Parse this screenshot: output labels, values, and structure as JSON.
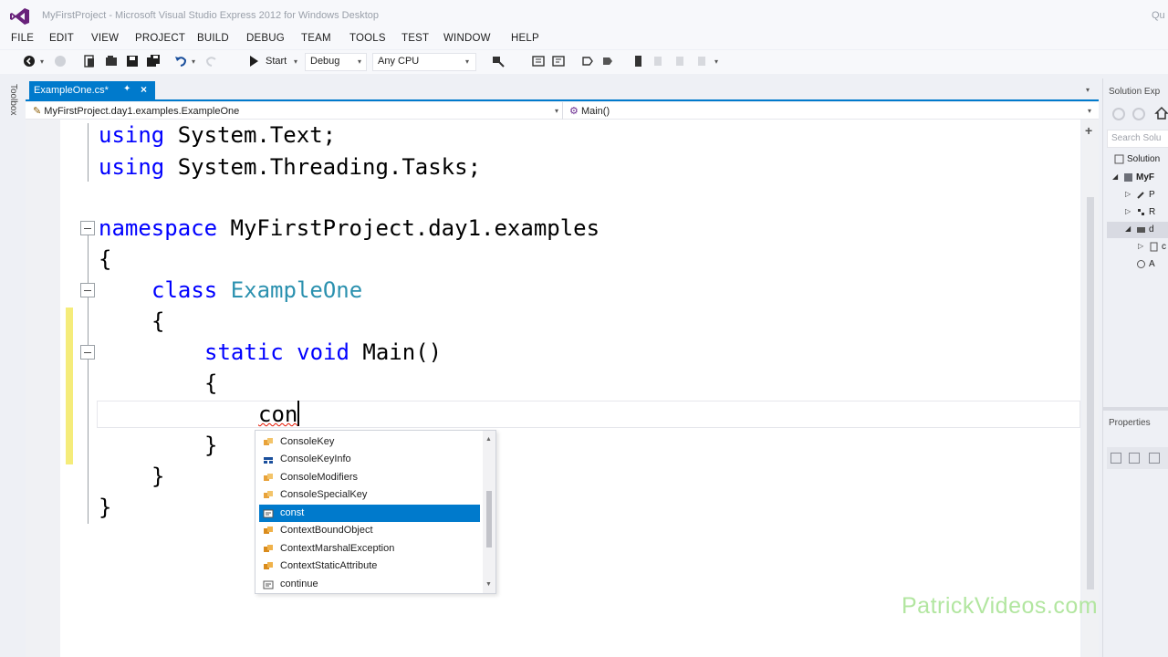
{
  "window": {
    "title": "MyFirstProject - Microsoft Visual Studio Express 2012 for Windows Desktop",
    "title_right": "Qu"
  },
  "menu": [
    "FILE",
    "EDIT",
    "VIEW",
    "PROJECT",
    "BUILD",
    "DEBUG",
    "TEAM",
    "TOOLS",
    "TEST",
    "WINDOW",
    "HELP"
  ],
  "toolbar": {
    "start_label": "Start",
    "configuration": "Debug",
    "platform": "Any CPU"
  },
  "toolbox": {
    "label": "Toolbox"
  },
  "document_tab": {
    "label": "ExampleOne.cs*",
    "pin": "✦",
    "close": "×"
  },
  "navigation": {
    "type_path": "MyFirstProject.day1.examples.ExampleOne",
    "member": "Main()"
  },
  "code": {
    "line1_keyword": "using",
    "line1_rest": " System.Text;",
    "line2_keyword": "using",
    "line2_rest": " System.Threading.Tasks;",
    "line3_keyword": "namespace",
    "line3_rest": " MyFirstProject.day1.examples",
    "line4": "{",
    "line5_keyword": "class",
    "line5_type": "ExampleOne",
    "line6": "{",
    "line7_kw1": "static",
    "line7_kw2": "void",
    "line7_rest": " Main()",
    "line8": "{",
    "line9_typed": "con",
    "line10": "}",
    "line11": "}",
    "line12": "}"
  },
  "intellisense": {
    "items": [
      {
        "label": "ConsoleKey",
        "icon": "enum-icon"
      },
      {
        "label": "ConsoleKeyInfo",
        "icon": "struct-icon"
      },
      {
        "label": "ConsoleModifiers",
        "icon": "enum-icon"
      },
      {
        "label": "ConsoleSpecialKey",
        "icon": "enum-icon"
      },
      {
        "label": "const",
        "icon": "keyword-icon",
        "selected": true
      },
      {
        "label": "ContextBoundObject",
        "icon": "class-icon"
      },
      {
        "label": "ContextMarshalException",
        "icon": "class-icon"
      },
      {
        "label": "ContextStaticAttribute",
        "icon": "class-icon"
      },
      {
        "label": "continue",
        "icon": "keyword-icon"
      }
    ]
  },
  "solution_explorer": {
    "title": "Solution Exp",
    "search_placeholder": "Search Solu",
    "rows": [
      {
        "label": "Solution",
        "icon": "solution-icon"
      },
      {
        "label": "MyF",
        "icon": "csharp-project-icon"
      },
      {
        "label": "P",
        "icon": "properties-icon"
      },
      {
        "label": "R",
        "icon": "references-icon"
      },
      {
        "label": "d",
        "icon": "folder-icon",
        "selected": true
      },
      {
        "label": "c",
        "icon": "file-icon"
      },
      {
        "label": "A",
        "icon": "config-icon"
      }
    ]
  },
  "properties": {
    "title": "Properties"
  },
  "watermark": "PatrickVideos.com",
  "colors": {
    "accent": "#007acc",
    "keyword": "#0000ff",
    "type": "#2b91af",
    "change_bar": "#f5ec7a",
    "watermark": "#b2e6a0"
  }
}
